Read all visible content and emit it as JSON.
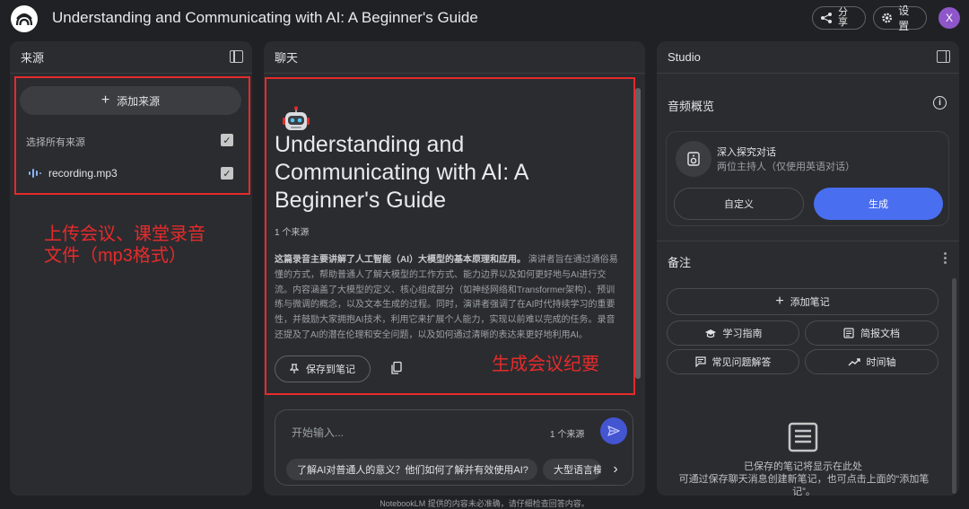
{
  "header": {
    "title": "Understanding and Communicating with AI: A Beginner's Guide",
    "share_label": "分享",
    "settings_label": "设置",
    "avatar_initial": "X"
  },
  "sources": {
    "title": "来源",
    "add_source_label": "添加来源",
    "select_all_label": "选择所有来源",
    "items": [
      {
        "name": "recording.mp3",
        "checked": true
      }
    ],
    "annotation": [
      "上传会议、课堂录音",
      "文件（mp3格式）"
    ]
  },
  "chat": {
    "title": "聊天",
    "doc_title": "Understanding and Communicating with AI: A Beginner's Guide",
    "source_count": "1 个来源",
    "summary_bold": "这篇录音主要讲解了人工智能（AI）大模型的基本原理和应用。",
    "summary_rest": "演讲者旨在通过通俗易懂的方式，帮助普通人了解大模型的工作方式、能力边界以及如何更好地与AI进行交流。内容涵盖了大模型的定义、核心组成部分（如神经网络和Transformer架构）、预训练与微调的概念，以及文本生成的过程。同时，演讲者强调了在AI时代持续学习的重要性，并鼓励大家拥抱AI技术，利用它来扩展个人能力，实现以前难以完成的任务。录音还提及了AI的潜在伦理和安全问题，以及如何通过清晰的表达来更好地利用AI。",
    "save_note_label": "保存到笔记",
    "annotation": "生成会议纪要",
    "input_placeholder": "开始输入...",
    "input_source_count": "1 个来源",
    "suggestions": [
      "了解AI对普通人的意义？他们如何了解并有效使用AI?",
      "大型语言模型"
    ]
  },
  "studio": {
    "title": "Studio",
    "audio_overview_title": "音频概览",
    "audio_item_title": "深入探究对话",
    "audio_item_sub": "两位主持人（仅使用英语对话）",
    "customize_label": "自定义",
    "generate_label": "生成",
    "notes_title": "备注",
    "add_note_label": "添加笔记",
    "study_guide_label": "学习指南",
    "brief_doc_label": "简报文档",
    "faq_label": "常见问题解答",
    "timeline_label": "时间轴",
    "empty_title": "已保存的笔记将显示在此处",
    "empty_desc": "可通过保存聊天消息创建新笔记，也可点击上面的“添加笔记”。"
  },
  "footer": {
    "text": "NotebookLM 提供的内容未必准确，请仔细检查回答内容。"
  },
  "colors": {
    "background": "#202124",
    "panel": "#2b2c30",
    "accent_blue": "#4a6ef0",
    "annotation_red": "#e52b2b"
  }
}
